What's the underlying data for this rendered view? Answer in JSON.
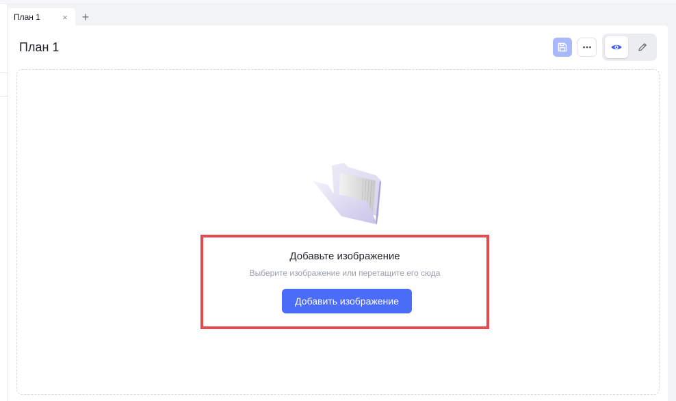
{
  "tabs": [
    {
      "label": "План 1",
      "close_glyph": "×"
    }
  ],
  "tab_add_glyph": "+",
  "header": {
    "title": "План 1"
  },
  "toolbar": {
    "save_icon": "save-icon",
    "more_icon": "more-horizontal-icon",
    "view_icon": "eye-icon",
    "edit_icon": "pencil-icon",
    "active_mode": "view"
  },
  "empty_state": {
    "illustration": "folder-illustration",
    "title": "Добавьте изображение",
    "subtitle": "Выберите изображение или перетащите его сюда",
    "button_label": "Добавить изображение"
  },
  "colors": {
    "accent": "#4a6cf7",
    "save_button": "#a9b7fb",
    "highlight_border": "#e5484d"
  }
}
